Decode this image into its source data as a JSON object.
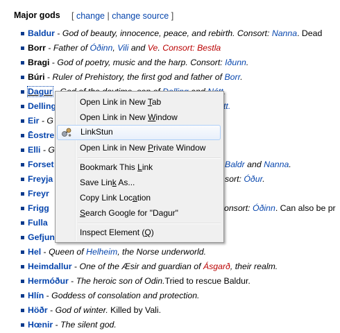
{
  "section": {
    "heading": "Major gods",
    "bracket_open": "[",
    "change": "change",
    "pipe": "|",
    "change_source": "change source",
    "bracket_close": "]"
  },
  "gods": [
    {
      "name": "Baldur",
      "desc": " - ",
      "i1": "God of beauty, innocence, peace, and rebirth. Consort: ",
      "l1": "Nanna",
      "t1": ". Dead"
    },
    {
      "name": "Borr",
      "desc": " - ",
      "i1": "Father of ",
      "l1": "Óðinn",
      "t1": ", ",
      "l2": "Vili",
      "t2": " and ",
      "l3": "Ve",
      "t3": ". ",
      "l4": "Consort: Bestla"
    },
    {
      "name": "Bragi",
      "desc": " - ",
      "i1": "God of poetry, music and the harp. Consort: ",
      "l1": "Iðunn",
      "t1": "."
    },
    {
      "name": "Búri",
      "desc": " - ",
      "i1": "Ruler of Prehistory, the first god and father of ",
      "l1": "Borr",
      "t1": "."
    },
    {
      "name": "Dagur",
      "desc": " - ",
      "i1": "God of the daytime, son of ",
      "l1": "Delling",
      "t1": " and ",
      "l2": "Nótt",
      "t2": "."
    },
    {
      "name": "Delling",
      "tail_link": "tt."
    },
    {
      "name": "Eir",
      "tail_text": " - G"
    },
    {
      "name": "Ēostre"
    },
    {
      "name": "Elli",
      "tail_text": " - G"
    },
    {
      "name": "Forset",
      "tail_link": "Baldr",
      "tail_mid": " and ",
      "tail_link2": "Nanna",
      "tail_end": "."
    },
    {
      "name": "Freyja",
      "tail_text2": "sort: ",
      "tail_link": "Óður",
      "tail_end": "."
    },
    {
      "name": "Freyr"
    },
    {
      "name": "Frigg",
      "tail_text2": "onsort: ",
      "tail_link": "Óðinn",
      "tail_end": ". Can also be pr"
    },
    {
      "name": "Fulla"
    },
    {
      "name": "Gefjun"
    },
    {
      "name": "Hel",
      "desc": " - ",
      "i1": "Queen of ",
      "l1": "Helheim",
      "t1": ", the Norse underworld."
    },
    {
      "name": "Heimdallur",
      "desc": " - ",
      "i1": "One of the Æsir and guardian of ",
      "l1": "Ásgarð",
      "t1": ", their realm."
    },
    {
      "name": "Hermóður",
      "desc": " - ",
      "i1": "The heroic son of Odin.",
      "t1": "Tried to rescue Baldur."
    },
    {
      "name": "Hlín",
      "desc": " - ",
      "i1": "Goddess of consolation and protection."
    },
    {
      "name": "Höðr",
      "desc": " - ",
      "i1": "God of winter.",
      "t1": " Killed by Vali."
    },
    {
      "name": "Hœnir",
      "desc": " - ",
      "i1": "The silent god."
    }
  ],
  "context_menu": {
    "items": [
      {
        "pre": "Open Link in New ",
        "acc": "T",
        "post": "ab"
      },
      {
        "pre": "Open Link in New ",
        "acc": "W",
        "post": "indow"
      },
      {
        "pre": "",
        "acc": "",
        "post": "LinkStun",
        "icon": "linkstun-icon"
      },
      {
        "pre": "Open Link in New ",
        "acc": "P",
        "post": "rivate Window"
      },
      {
        "pre": "Bookmark This ",
        "acc": "L",
        "post": "ink"
      },
      {
        "pre": "Save Lin",
        "acc": "k",
        "post": " As..."
      },
      {
        "pre": "Copy Link Loc",
        "acc": "a",
        "post": "tion"
      },
      {
        "pre": "",
        "acc": "S",
        "post": "earch Google for \"Dagur\""
      },
      {
        "pre": "Inspect Element (",
        "acc": "Q",
        "post": ")"
      }
    ]
  }
}
